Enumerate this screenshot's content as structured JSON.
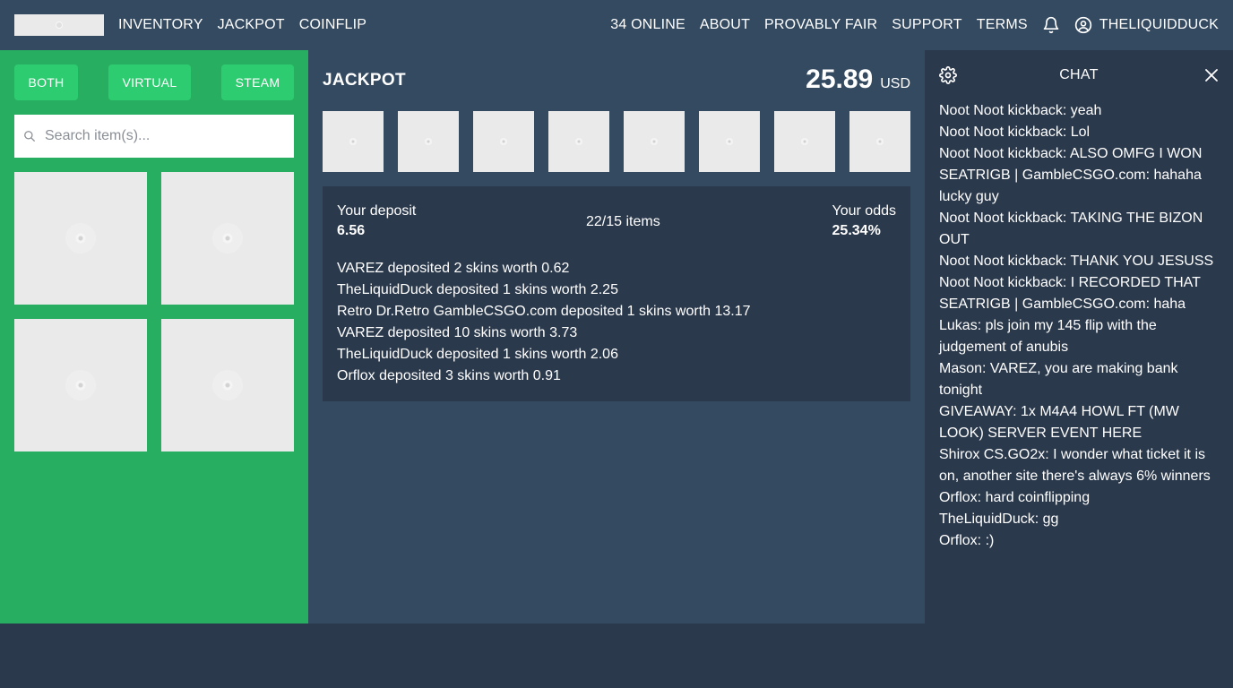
{
  "nav": {
    "left_links": [
      "INVENTORY",
      "JACKPOT",
      "COINFLIP"
    ],
    "online": "34 ONLINE",
    "right_links": [
      "ABOUT",
      "PROVABLY FAIR",
      "SUPPORT",
      "TERMS"
    ],
    "username": "THELIQUIDDUCK"
  },
  "inventory": {
    "filters": [
      "BOTH",
      "VIRTUAL",
      "STEAM"
    ],
    "search_placeholder": "Search item(s)..."
  },
  "jackpot": {
    "title": "JACKPOT",
    "amount": "25.89",
    "currency": "USD",
    "deposit_label": "Your deposit",
    "deposit_value": "6.56",
    "items_count": "22/15 items",
    "odds_label": "Your odds",
    "odds_value": "25.34%",
    "log": [
      "VAREZ deposited 2 skins worth 0.62",
      "TheLiquidDuck deposited 1 skins worth 2.25",
      "Retro Dr.Retro GambleCSGO.com deposited 1 skins worth 13.17",
      "VAREZ deposited 10 skins worth 3.73",
      "TheLiquidDuck deposited 1 skins worth 2.06",
      "Orflox deposited 3 skins worth 0.91"
    ]
  },
  "chat": {
    "title": "CHAT",
    "messages": [
      "Noot Noot kickback: yeah",
      "Noot Noot kickback: Lol",
      "Noot Noot kickback: ALSO OMFG I WON",
      "SEATRIGB | GambleCSGO.com: hahaha lucky guy",
      "Noot Noot kickback: TAKING THE BIZON OUT",
      "Noot Noot kickback: THANK YOU JESUSS",
      "Noot Noot kickback: I RECORDED THAT",
      "SEATRIGB | GambleCSGO.com: haha",
      "Lukas: pls join my 145 flip with the judgement of anubis",
      "Mason: VAREZ, you are making bank tonight",
      "GIVEAWAY: 1x M4A4 HOWL FT (MW LOOK) SERVER EVENT HERE",
      "Shirox CS.GO2x: I wonder what ticket it is on, another site there's always 6% winners",
      "Orflox: hard coinflipping",
      "TheLiquidDuck: gg",
      "Orflox: :)"
    ]
  },
  "colors": {
    "topbar": "#344a61",
    "background": "#2b394c",
    "inventory_panel": "#27ae60",
    "filter_button": "#2ecc71",
    "placeholder_tile": "#eaeaea"
  }
}
